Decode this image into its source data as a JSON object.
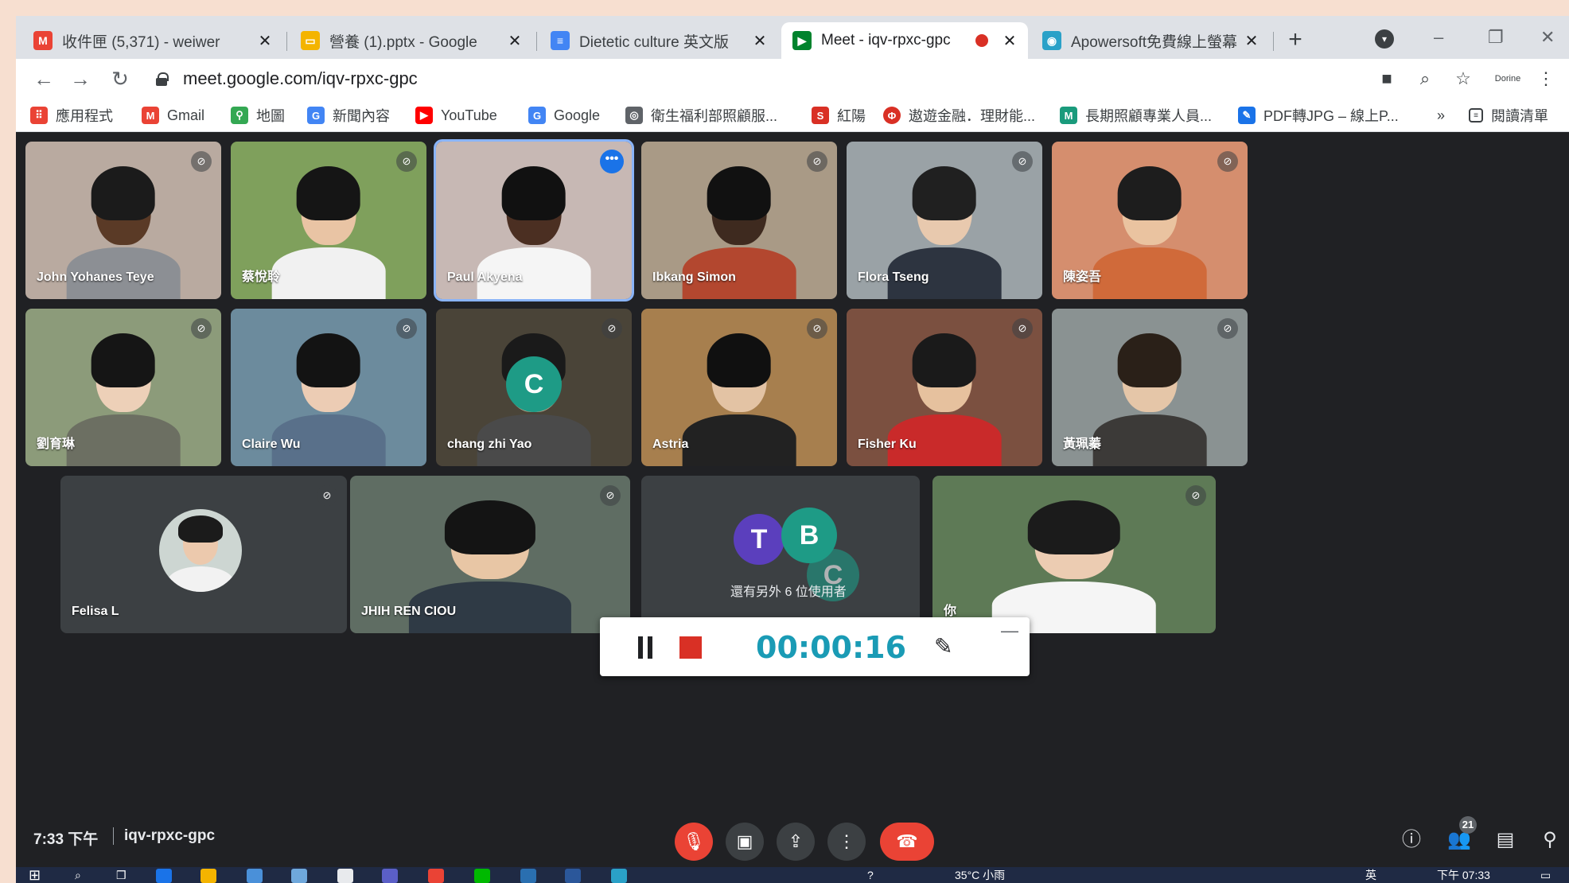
{
  "browser": {
    "tabs": [
      {
        "title": "收件匣 (5,371) - weiwer",
        "favicon": "gmail-icon",
        "color": "#ea4335"
      },
      {
        "title": "營養 (1).pptx - Google",
        "favicon": "slides-icon",
        "color": "#f4b400"
      },
      {
        "title": "Dietetic culture 英文版",
        "favicon": "docs-icon",
        "color": "#4285f4"
      },
      {
        "title": "Meet - iqv-rpxc-gpc",
        "favicon": "meet-icon",
        "color": "#00832d",
        "active": true,
        "recording": true
      },
      {
        "title": "Apowersoft免費線上螢幕",
        "favicon": "apowersoft-icon",
        "color": "#2aa1c8"
      }
    ],
    "close_glyph": "✕",
    "new_tab": "+",
    "url": "meet.google.com/iqv-rpxc-gpc",
    "profile_label": "Dorine",
    "bookmarks": [
      {
        "label": "應用程式",
        "icon": "apps-grid-icon",
        "color": "#ea4335"
      },
      {
        "label": "Gmail",
        "icon": "gmail-icon",
        "color": "#ea4335"
      },
      {
        "label": "地圖",
        "icon": "maps-pin-icon",
        "color": "#34a853"
      },
      {
        "label": "新聞內容",
        "icon": "news-icon",
        "color": "#4285f4"
      },
      {
        "label": "YouTube",
        "icon": "youtube-icon",
        "color": "#ff0000"
      },
      {
        "label": "Google",
        "icon": "google-icon",
        "color": "#4285f4"
      },
      {
        "label": "衛生福利部照顧服...",
        "icon": "globe-icon",
        "color": "#5f6368"
      },
      {
        "label": "紅陽",
        "icon": "sunny-icon",
        "color": "#d93025"
      },
      {
        "label": "遨遊金融．理財能...",
        "icon": "finance-icon",
        "color": "#d93025"
      },
      {
        "label": "長期照顧專業人員...",
        "icon": "care-icon",
        "color": "#1a9b7c"
      },
      {
        "label": "PDF轉JPG – 線上P...",
        "icon": "pdf-feather-icon",
        "color": "#1a73e8"
      }
    ],
    "more_bookmarks": "»",
    "reading_list": "閱讀清單"
  },
  "meet": {
    "participants": [
      {
        "name": "John Yohanes Teye",
        "bg": "#b9aaa0",
        "skin": "#5a3a26",
        "shirt": "#8c8f94",
        "hair": "#1b1b1b"
      },
      {
        "name": "蔡悅聆",
        "bg": "#7fa05c",
        "skin": "#e9c4a4",
        "shirt": "#f1f1f1",
        "hair": "#151515"
      },
      {
        "name": "Paul Akyena",
        "bg": "#c7b8b4",
        "skin": "#4b2f22",
        "shirt": "#f5f5f5",
        "hair": "#111111",
        "pinned": true
      },
      {
        "name": "Ibkang Simon",
        "bg": "#a99a86",
        "skin": "#3e2a1f",
        "shirt": "#b3472f",
        "hair": "#111111"
      },
      {
        "name": "Flora Tseng",
        "bg": "#9aa2a6",
        "skin": "#e8c9ae",
        "shirt": "#2d3440",
        "hair": "#202020"
      },
      {
        "name": "陳姿吾",
        "bg": "#d58e6e",
        "skin": "#eac3a0",
        "shirt": "#d06a3a",
        "hair": "#1d1d1d"
      },
      {
        "name": "劉育琳",
        "bg": "#8c9b7a",
        "skin": "#edd0b8",
        "shirt": "#6c6f62",
        "hair": "#151515"
      },
      {
        "name": "Claire Wu",
        "bg": "#6c8b9d",
        "skin": "#ecccb4",
        "shirt": "#59708a",
        "hair": "#131313"
      },
      {
        "name": "chang zhi Yao",
        "bg": "#4a4438",
        "skin": "#c8a88c",
        "shirt": "#4a4a4a",
        "hair": "#1a1a1a",
        "avatar_letter": "C",
        "avatar_color": "#1e9b86"
      },
      {
        "name": "Astria",
        "bg": "#a77f4e",
        "skin": "#e3c3a4",
        "shirt": "#222222",
        "hair": "#101010"
      },
      {
        "name": "Fisher Ku",
        "bg": "#7b5040",
        "skin": "#e6c19e",
        "shirt": "#c92a2a",
        "hair": "#1a1a1a"
      },
      {
        "name": "黃珮蓁",
        "bg": "#8a9292",
        "skin": "#e5c6a8",
        "shirt": "#3c3a38",
        "hair": "#2a2018"
      },
      {
        "name": "Felisa L",
        "bg": "#3c4043",
        "skin": "#ecc9ad",
        "shirt": "#f2f2f2",
        "hair": "#1b1b1b",
        "photo_avatar": true
      },
      {
        "name": "JHIH REN CIOU",
        "bg": "#5f6d63",
        "skin": "#e8c6a5",
        "shirt": "#2f3a45",
        "hair": "#141414"
      },
      {
        "name": "你",
        "bg": "#5e7a56",
        "skin": "#ecccb2",
        "shirt": "#f5f5f5",
        "hair": "#1b1b1b"
      }
    ],
    "overflow": {
      "text": "還有另外 6 位使用者",
      "avatars": [
        {
          "letter": "T",
          "color": "#5b3fbd"
        },
        {
          "letter": "B",
          "color": "#1e9b86"
        },
        {
          "letter": "C",
          "color": "#1e9b86"
        }
      ]
    },
    "more_options_glyph": "•••",
    "muted_glyph": "🎙",
    "time": "7:33 下午",
    "meeting_code": "iqv-rpxc-gpc",
    "people_count": "21",
    "controls": {
      "mic": "mic-off-icon",
      "camera": "camera-icon",
      "present": "present-screen-icon",
      "more": "more-vert-icon",
      "leave": "leave-call-icon"
    }
  },
  "recorder": {
    "time": "00:00:16"
  },
  "taskbar": {
    "weather": "35°C 小雨",
    "ime": "英",
    "clock_time": "下午 07:33"
  }
}
